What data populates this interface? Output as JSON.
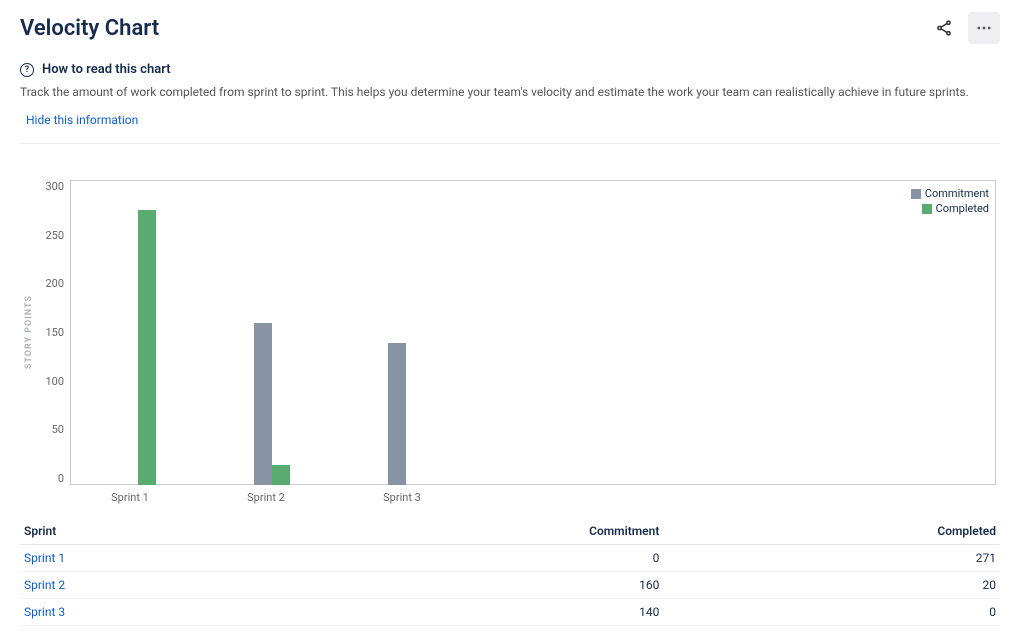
{
  "header": {
    "title": "Velocity Chart"
  },
  "info": {
    "heading": "How to read this chart",
    "description": "Track the amount of work completed from sprint to sprint. This helps you determine your team's velocity and estimate the work your team can realistically achieve in future sprints.",
    "hide_link": "Hide this information"
  },
  "legend": {
    "commitment": "Commitment",
    "completed": "Completed"
  },
  "table": {
    "col_sprint": "Sprint",
    "col_commitment": "Commitment",
    "col_completed": "Completed",
    "rows": [
      {
        "sprint": "Sprint 1",
        "commitment": "0",
        "completed": "271"
      },
      {
        "sprint": "Sprint 2",
        "commitment": "160",
        "completed": "20"
      },
      {
        "sprint": "Sprint 3",
        "commitment": "140",
        "completed": "0"
      }
    ]
  },
  "yticks": [
    "300",
    "250",
    "200",
    "150",
    "100",
    "50",
    "0"
  ],
  "ylabel": "STORY POINTS",
  "chart_data": {
    "type": "bar",
    "categories": [
      "Sprint 1",
      "Sprint 2",
      "Sprint 3"
    ],
    "series": [
      {
        "name": "Commitment",
        "values": [
          0,
          160,
          140
        ],
        "color": "#8993a6"
      },
      {
        "name": "Completed",
        "values": [
          271,
          20,
          0
        ],
        "color": "#5aab70"
      }
    ],
    "title": "Velocity Chart",
    "xlabel": "",
    "ylabel": "STORY POINTS",
    "ylim": [
      0,
      300
    ]
  }
}
